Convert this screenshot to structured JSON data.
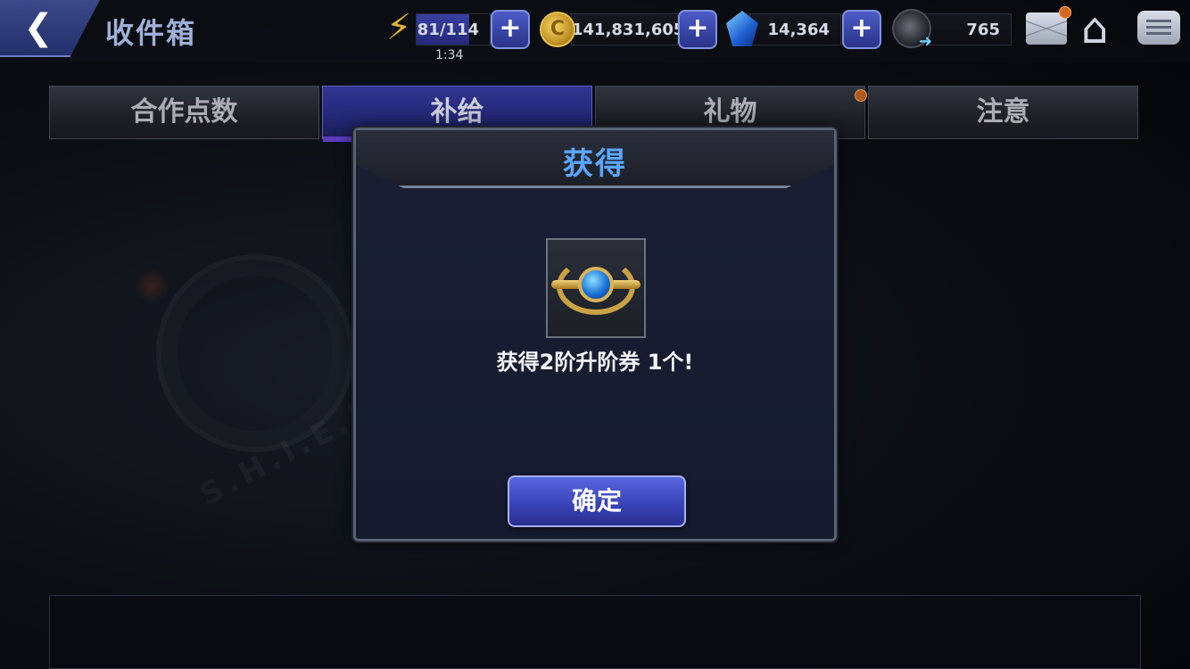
{
  "header": {
    "title": "收件箱",
    "back_icon": "chevron-left-icon"
  },
  "resources": {
    "energy": {
      "value": "81/114",
      "timer": "1:34",
      "fill_fraction": 0.71,
      "icon": "lightning-icon"
    },
    "gold": {
      "value": "141,831,605",
      "icon": "gold-coin-icon"
    },
    "crystals": {
      "value": "14,364",
      "icon": "blue-crystal-icon"
    },
    "shards": {
      "value": "765",
      "icon": "shard-icon"
    },
    "plus_label": "+"
  },
  "nav_icons": {
    "mail": "mail-icon",
    "home": "home-icon",
    "chat": "chat-icon"
  },
  "tabs": [
    {
      "label": "合作点数",
      "active": false
    },
    {
      "label": "补给",
      "active": true
    },
    {
      "label": "礼物",
      "active": false,
      "notification": true
    },
    {
      "label": "注意",
      "active": false
    }
  ],
  "dialog": {
    "title": "获得",
    "reward_icon": "tier-2-upgrade-ticket-icon",
    "message": "获得2阶升阶券 1个!",
    "confirm_label": "确定"
  },
  "colors": {
    "accent_blue": "#5aa8ff",
    "button_purple": "#3a44b8",
    "notification": "#d2691e"
  }
}
